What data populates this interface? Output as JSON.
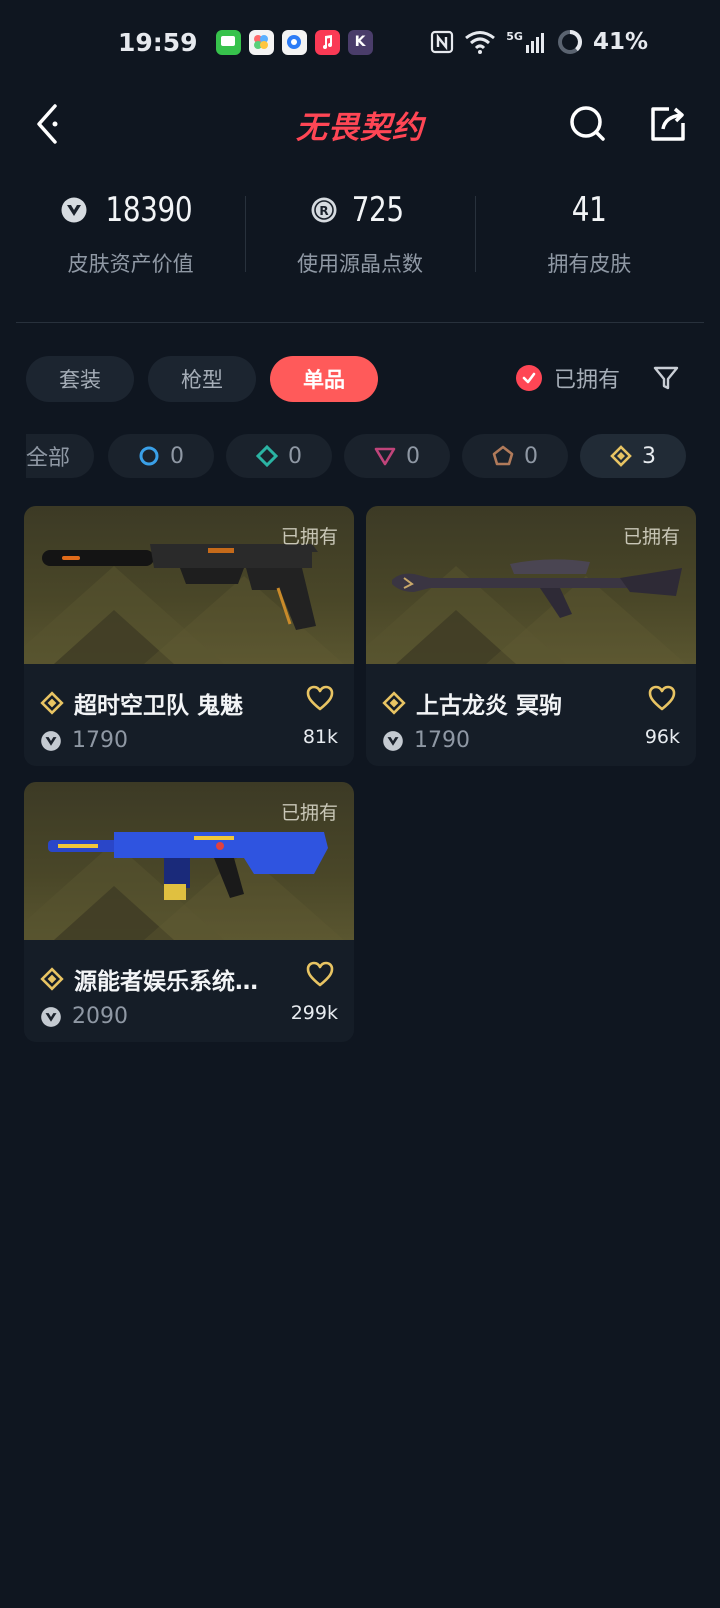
{
  "status_bar": {
    "time": "19:59",
    "network": "5G",
    "battery": "41%",
    "notif_icons": [
      "messages-icon",
      "gallery-icon",
      "compass-icon",
      "music-icon",
      "k-app-icon"
    ]
  },
  "header": {
    "title": "无畏契约",
    "back_icon": "chevron-left-icon",
    "search_icon": "search-icon",
    "share_icon": "share-icon"
  },
  "stats": [
    {
      "value": "18390",
      "label": "皮肤资产价值",
      "icon": "valorant-points-icon"
    },
    {
      "value": "725",
      "label": "使用源晶点数",
      "icon": "radianite-points-icon"
    },
    {
      "value": "41",
      "label": "拥有皮肤",
      "icon": ""
    }
  ],
  "tabs": [
    {
      "label": "套装",
      "active": false
    },
    {
      "label": "枪型",
      "active": false
    },
    {
      "label": "单品",
      "active": true
    }
  ],
  "owned_filter": {
    "label": "已拥有",
    "checked": true
  },
  "rarity_filters": [
    {
      "label": "全部",
      "count": ""
    },
    {
      "icon": "circle-tier-icon",
      "count": "0",
      "color": "#3aa0e8"
    },
    {
      "icon": "diamond-tier-icon",
      "count": "0",
      "color": "#2bb3a3"
    },
    {
      "icon": "triangle-tier-icon",
      "count": "0",
      "color": "#c0447a"
    },
    {
      "icon": "pentagon-tier-icon",
      "count": "0",
      "color": "#b07a5a"
    },
    {
      "icon": "gold-diamond-tier-icon",
      "count": "3",
      "color": "#e8c463",
      "selected": true
    }
  ],
  "skins": [
    {
      "name": "超时空卫队 鬼魅",
      "price": "1790",
      "likes": "81k",
      "owned_tag": "已拥有"
    },
    {
      "name": "上古龙炎 冥驹",
      "price": "1790",
      "likes": "96k",
      "owned_tag": "已拥有"
    },
    {
      "name": "源能者娱乐系统…",
      "price": "2090",
      "likes": "299k",
      "owned_tag": "已拥有"
    }
  ],
  "colors": {
    "accent": "#ff4655",
    "gold": "#e8c463",
    "background": "#0f1620"
  }
}
